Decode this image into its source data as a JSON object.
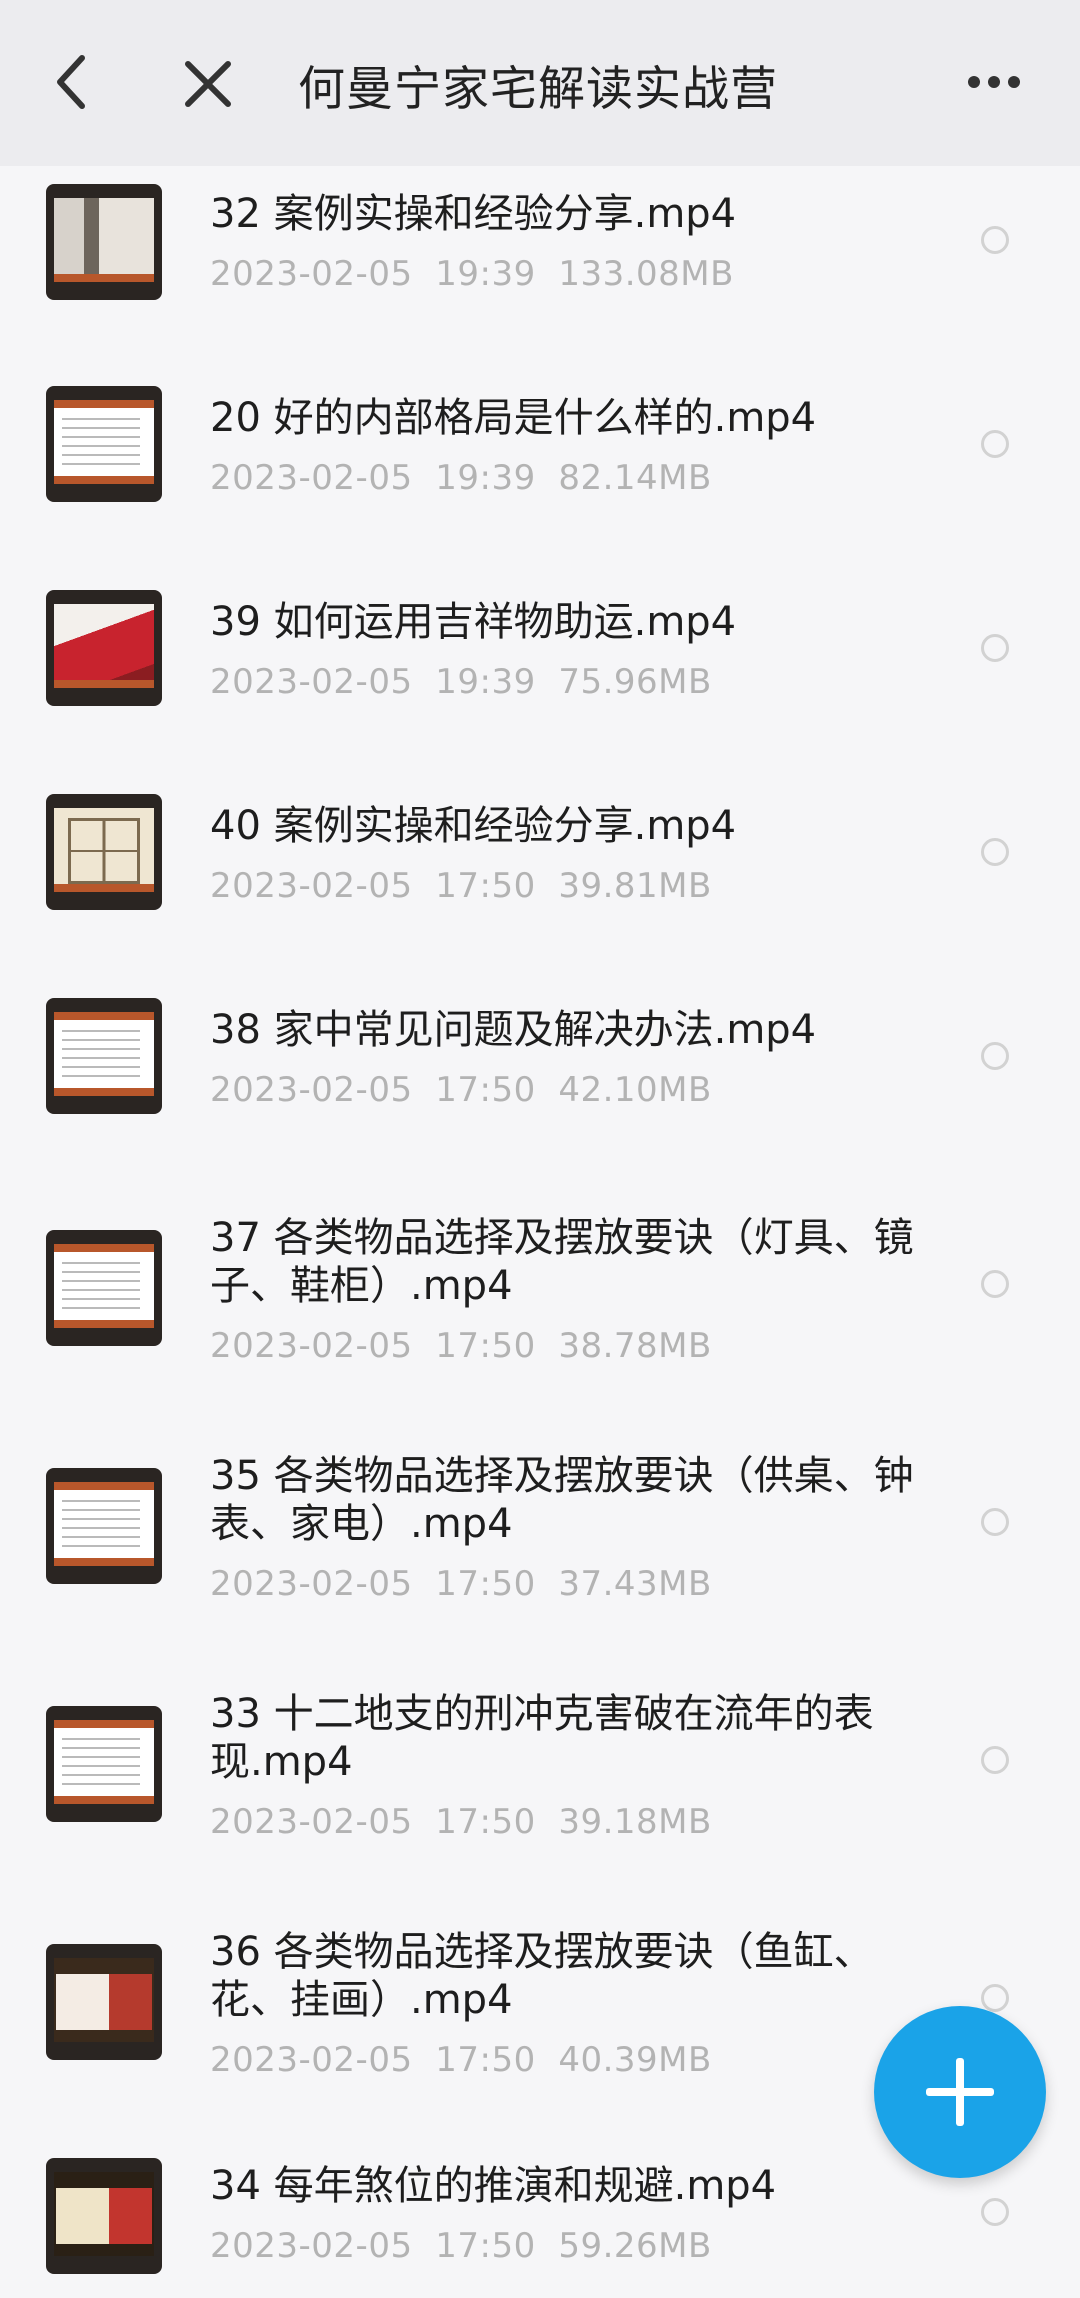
{
  "header": {
    "title": "何曼宁家宅解读实战营",
    "back_icon": "chevron-left-icon",
    "close_icon": "close-icon",
    "more_icon": "more-horizontal-icon"
  },
  "files": [
    {
      "name": "32 案例实操和经验分享.mp4",
      "date": "2023-02-05",
      "time": "19:39",
      "size": "133.08MB",
      "thumb": "photo"
    },
    {
      "name": "20 好的内部格局是什么样的.mp4",
      "date": "2023-02-05",
      "time": "19:39",
      "size": "82.14MB",
      "thumb": "text"
    },
    {
      "name": "39 如何运用吉祥物助运.mp4",
      "date": "2023-02-05",
      "time": "19:39",
      "size": "75.96MB",
      "thumb": "red"
    },
    {
      "name": "40 案例实操和经验分享.mp4",
      "date": "2023-02-05",
      "time": "17:50",
      "size": "39.81MB",
      "thumb": "plan"
    },
    {
      "name": "38 家中常见问题及解决办法.mp4",
      "date": "2023-02-05",
      "time": "17:50",
      "size": "42.10MB",
      "thumb": "text"
    },
    {
      "name": "37 各类物品选择及摆放要诀（灯具、镜子、鞋柜）.mp4",
      "date": "2023-02-05",
      "time": "17:50",
      "size": "38.78MB",
      "thumb": "text"
    },
    {
      "name": "35 各类物品选择及摆放要诀（供桌、钟表、家电）.mp4",
      "date": "2023-02-05",
      "time": "17:50",
      "size": "37.43MB",
      "thumb": "text"
    },
    {
      "name": "33 十二地支的刑冲克害破在流年的表现.mp4",
      "date": "2023-02-05",
      "time": "17:50",
      "size": "39.18MB",
      "thumb": "text"
    },
    {
      "name": "36 各类物品选择及摆放要诀（鱼缸、花、挂画）.mp4",
      "date": "2023-02-05",
      "time": "17:50",
      "size": "40.39MB",
      "thumb": "gold"
    },
    {
      "name": "34 每年煞位的推演和规避.mp4",
      "date": "2023-02-05",
      "time": "17:50",
      "size": "59.26MB",
      "thumb": "gold2"
    }
  ],
  "fab": {
    "icon": "plus-icon"
  },
  "colors": {
    "accent": "#1aa3e8",
    "header_bg": "#ececef",
    "meta_text": "#b3b3b3"
  }
}
